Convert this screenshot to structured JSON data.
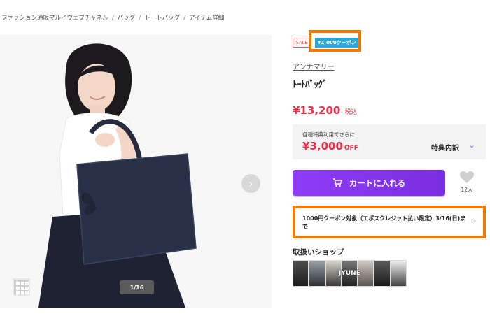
{
  "breadcrumb": [
    "ファッション通販マルイウェブチャネル",
    "バッグ",
    "トートバッグ",
    "アイテム詳細"
  ],
  "gallery": {
    "counter": "1/16",
    "next_icon": "chevron-right-icon",
    "grid_icon": "grid-icon"
  },
  "badges": {
    "sale": "SALE",
    "coupon": "¥1,000クーポン"
  },
  "product": {
    "brand": "アンナマリー",
    "name": "ﾄｰﾄﾊﾞｯｸﾞ",
    "price": "¥13,200",
    "tax_label": "税込"
  },
  "benefit": {
    "caption": "各種特典利用でさらに",
    "amount": "¥3,000",
    "off": "OFF",
    "detail_label": "特典内訳"
  },
  "cart": {
    "label": "カートに入れる",
    "icon": "cart-icon"
  },
  "favorite": {
    "count": "12人",
    "icon": "heart-icon"
  },
  "coupon_notice": {
    "text": "1000円クーポン対象（エポスクレジット払い限定）3/16(日)まで"
  },
  "shops": {
    "title": "取扱いショップ",
    "logo_text": "JYUNE",
    "thumb_colors": [
      "#6b6b6b",
      "#8a8f96",
      "#3d3d3d",
      "#7a6f63",
      "#2d2d33",
      "#a0a09a",
      "#4b4a48",
      "#b8b3aa",
      "#5a5a5a",
      "#2b2b2b",
      "#8c8c8c",
      "#e8e8e8",
      "#6f6a66"
    ]
  },
  "colors": {
    "accent": "#7b3bf0",
    "price": "#e8304a",
    "highlight": "#f07a00",
    "coupon": "#2aa8d8"
  }
}
